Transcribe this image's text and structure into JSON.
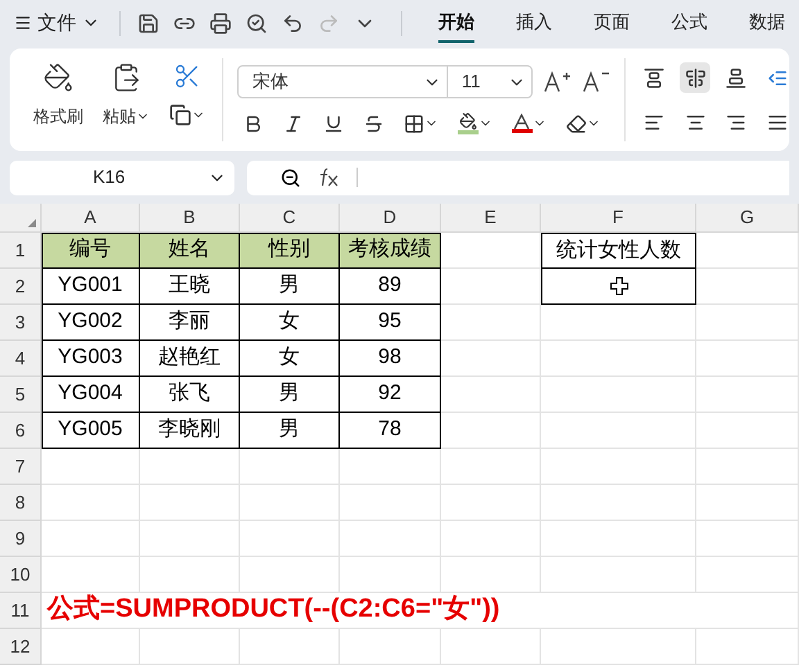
{
  "menu": {
    "label": "文件"
  },
  "tabs": [
    {
      "label": "开始",
      "selected": true
    },
    {
      "label": "插入",
      "selected": false
    },
    {
      "label": "页面",
      "selected": false
    },
    {
      "label": "公式",
      "selected": false
    },
    {
      "label": "数据",
      "selected": false
    }
  ],
  "ribbon": {
    "format_painter": "格式刷",
    "paste": "粘贴",
    "font": "宋体",
    "size": "11"
  },
  "name_box": "K16",
  "sheet": {
    "columns": [
      "A",
      "B",
      "C",
      "D",
      "E",
      "F",
      "G"
    ],
    "rows": [
      "1",
      "2",
      "3",
      "4",
      "5",
      "6",
      "7",
      "8",
      "9",
      "10",
      "11",
      "12"
    ],
    "data_table": {
      "headers": [
        "编号",
        "姓名",
        "性别",
        "考核成绩"
      ],
      "rows": [
        [
          "YG001",
          "王晓",
          "男",
          "89"
        ],
        [
          "YG002",
          "李丽",
          "女",
          "95"
        ],
        [
          "YG003",
          "赵艳红",
          "女",
          "98"
        ],
        [
          "YG004",
          "张飞",
          "男",
          "92"
        ],
        [
          "YG005",
          "李晓刚",
          "男",
          "78"
        ]
      ]
    },
    "summary_label": "统计女性人数",
    "note": "公式=SUMPRODUCT(--(C2:C6=\"女\"))"
  }
}
